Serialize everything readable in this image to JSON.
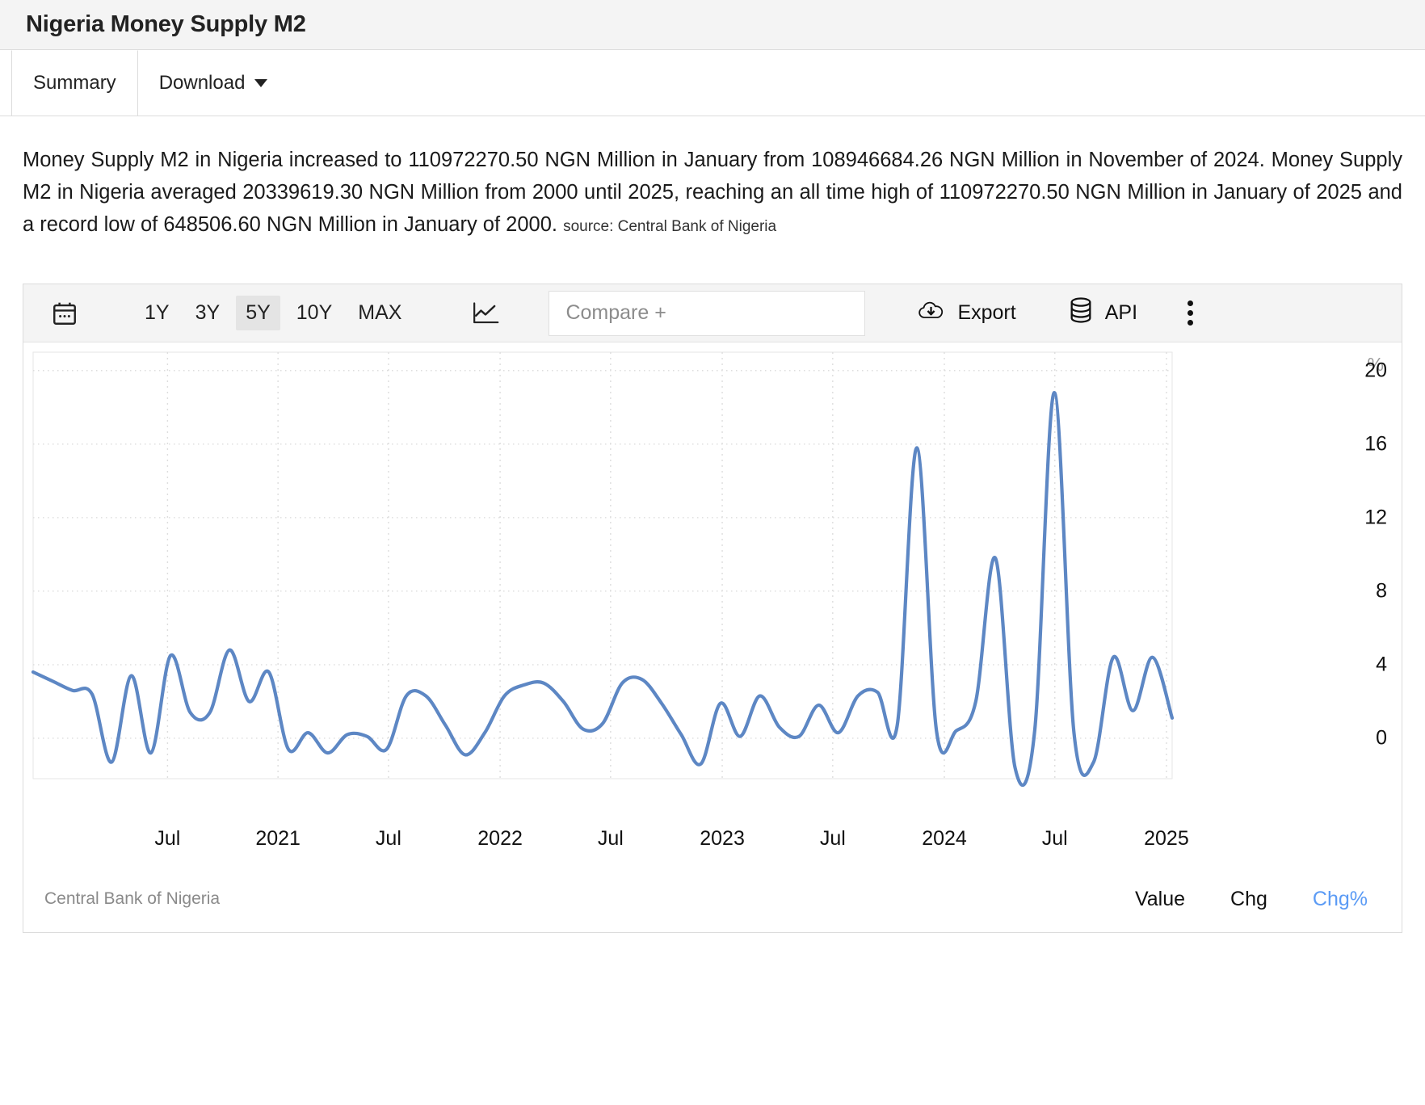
{
  "header": {
    "title": "Nigeria Money Supply M2"
  },
  "tabs": [
    {
      "label": "Summary",
      "active": true
    },
    {
      "label": "Download",
      "active": false,
      "has_caret": true
    }
  ],
  "summary": {
    "text": "Money Supply M2 in Nigeria increased to 110972270.50 NGN Million in January from 108946684.26 NGN Million in November of 2024. Money Supply M2 in Nigeria averaged 20339619.30 NGN Million from 2000 until 2025, reaching an all time high of 110972270.50 NGN Million in January of 2025 and a record low of 648506.60 NGN Million in January of 2000.",
    "source": "source: Central Bank of Nigeria"
  },
  "toolbar": {
    "calendar_icon": "calendar-icon",
    "ranges": [
      {
        "label": "1Y",
        "active": false
      },
      {
        "label": "3Y",
        "active": false
      },
      {
        "label": "5Y",
        "active": true
      },
      {
        "label": "10Y",
        "active": false
      },
      {
        "label": "MAX",
        "active": false
      }
    ],
    "chart_type_icon": "line-chart-icon",
    "compare_placeholder": "Compare +",
    "export_label": "Export",
    "export_icon": "cloud-download-icon",
    "api_label": "API",
    "api_icon": "database-icon",
    "more_icon": "kebab-menu-icon"
  },
  "footer": {
    "source": "Central Bank of Nigeria",
    "series_tabs": [
      {
        "label": "Value",
        "active": false
      },
      {
        "label": "Chg",
        "active": false
      },
      {
        "label": "Chg%",
        "active": true
      }
    ]
  },
  "colors": {
    "line": "#5d87c4",
    "accent": "#5b9bf5",
    "grid": "#dddddd",
    "toolbar_bg": "#f4f4f4"
  },
  "chart_data": {
    "type": "line",
    "title": "Nigeria Money Supply M2",
    "xlabel": "",
    "ylabel": "%",
    "unit": "%",
    "ylim": [
      -2.2,
      21.0
    ],
    "yticks": [
      0,
      4,
      8,
      12,
      16,
      20
    ],
    "xticks": [
      "Jul",
      "2021",
      "Jul",
      "2022",
      "Jul",
      "2023",
      "Jul",
      "2024",
      "Jul",
      "2025"
    ],
    "xtick_positions": [
      0.118,
      0.215,
      0.312,
      0.41,
      0.507,
      0.605,
      0.702,
      0.8,
      0.897,
      0.995
    ],
    "grid": true,
    "legend": "none",
    "series": [
      {
        "name": "Chg%",
        "x": [
          "2020-02",
          "2020-03",
          "2020-04",
          "2020-05",
          "2020-06",
          "2020-07",
          "2020-08",
          "2020-09",
          "2020-10",
          "2020-11",
          "2020-12",
          "2021-01",
          "2021-02",
          "2021-03",
          "2021-04",
          "2021-05",
          "2021-06",
          "2021-07",
          "2021-08",
          "2021-09",
          "2021-10",
          "2021-11",
          "2021-12",
          "2022-01",
          "2022-02",
          "2022-03",
          "2022-04",
          "2022-05",
          "2022-06",
          "2022-07",
          "2022-08",
          "2022-09",
          "2022-10",
          "2022-11",
          "2022-12",
          "2023-01",
          "2023-02",
          "2023-03",
          "2023-04",
          "2023-05",
          "2023-06",
          "2023-07",
          "2023-08",
          "2023-09",
          "2023-10",
          "2023-11",
          "2023-12",
          "2024-01",
          "2024-02",
          "2024-03",
          "2024-04",
          "2024-05",
          "2024-06",
          "2024-07",
          "2024-08",
          "2024-09",
          "2024-10",
          "2024-11",
          "2025-01"
        ],
        "values": [
          3.6,
          3.1,
          2.6,
          2.4,
          -1.3,
          3.4,
          -0.8,
          4.5,
          1.4,
          1.4,
          4.8,
          2.0,
          3.6,
          -0.6,
          0.3,
          -0.8,
          0.2,
          0.1,
          -0.6,
          2.3,
          2.3,
          0.7,
          -0.9,
          0.3,
          2.3,
          2.9,
          3.0,
          2.0,
          0.5,
          0.8,
          3.0,
          3.2,
          1.9,
          0.2,
          -1.4,
          1.9,
          0.1,
          2.3,
          0.6,
          0.1,
          1.8,
          0.3,
          2.3,
          2.5,
          0.7,
          15.8,
          0.4,
          0.4,
          2.0,
          9.8,
          -1.6,
          0.4,
          18.8,
          0.3,
          -1.3,
          4.4,
          1.5,
          4.4,
          1.1
        ]
      }
    ],
    "annotations": {
      "peak_1": {
        "x": "2023-11",
        "y": 15.8
      },
      "peak_2": {
        "x": "2024-03",
        "y": 9.8
      },
      "peak_3": {
        "x": "2024-06",
        "y": 18.8
      }
    }
  }
}
